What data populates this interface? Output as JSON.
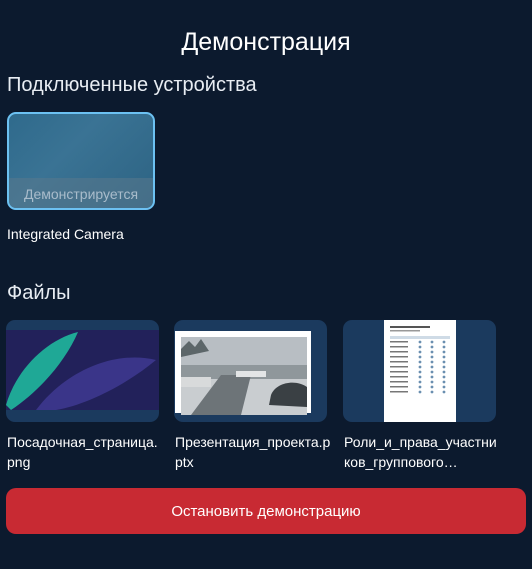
{
  "header": {
    "title": "Демонстрация"
  },
  "devices": {
    "section_label": "Подключенные устройства",
    "items": [
      {
        "name": "Integrated Camera",
        "status": "Демонстрируется",
        "active": true
      }
    ]
  },
  "files": {
    "section_label": "Файлы",
    "items": [
      {
        "name": "Посадочная_страница.png",
        "thumbnail": "image-icon"
      },
      {
        "name": "Презентация_проекта.pptx",
        "thumbnail": "photo-icon"
      },
      {
        "name": "Роли_и_права_участников_группового…",
        "thumbnail": "document-icon"
      }
    ]
  },
  "footer": {
    "stop_label": "Остановить демонстрацию"
  },
  "colors": {
    "background": "#0c1a2e",
    "accent": "#6cc1f2",
    "danger": "#c82a33",
    "card": "#1b3a5e"
  }
}
